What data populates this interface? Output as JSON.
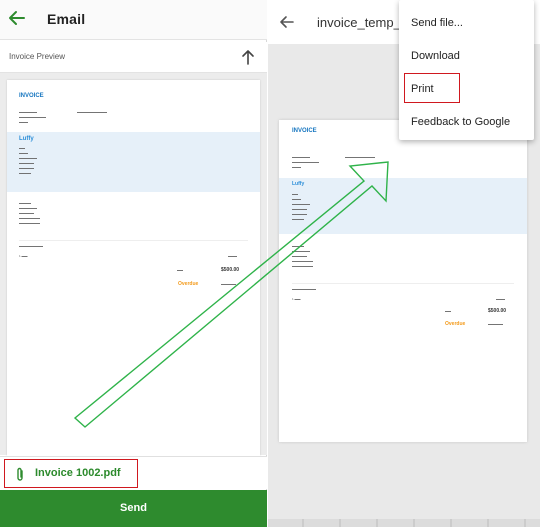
{
  "left": {
    "title": "Email",
    "preview_label": "Invoice Preview",
    "attachment_name": "Invoice 1002.pdf",
    "send_label": "Send"
  },
  "right": {
    "title": "invoice_temp_"
  },
  "menu": {
    "items": [
      "Send file...",
      "Download",
      "Print",
      "Feedback to Google"
    ]
  },
  "invoice_left": {
    "title": "INVOICE",
    "company": "Luffy",
    "overdue": "Overdue",
    "total": "$500.00"
  },
  "invoice_right": {
    "title": "INVOICE",
    "company": "Luffy",
    "overdue": "Overdue",
    "total": "$500.00"
  },
  "colors": {
    "green_accent": "#2e8b2e",
    "highlight_red": "#d0181f",
    "invoice_blue": "#1676c0",
    "overdue_orange": "#f39a1a"
  }
}
